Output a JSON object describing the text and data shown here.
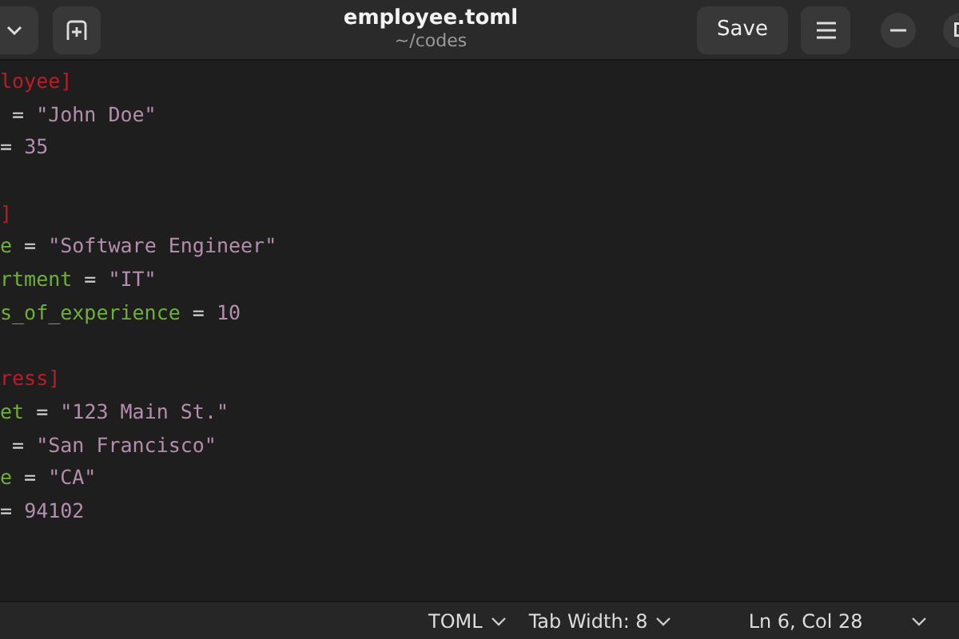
{
  "window": {
    "title": "employee.toml",
    "subtitle": "~/codes"
  },
  "header_buttons": [
    {
      "kind": "dropdown"
    },
    {
      "kind": "new-tab"
    }
  ],
  "save_button": "Save",
  "editor": {
    "blocks": [
      [
        [
          {
            "kind": "header",
            "text": "loyee]"
          }
        ],
        [
          {
            "kind": "op",
            "text": " = "
          },
          {
            "kind": "value",
            "text": "\"John Doe\""
          }
        ],
        [
          {
            "kind": "op",
            "text": "= "
          },
          {
            "kind": "value",
            "text": "35"
          }
        ]
      ],
      [
        [
          {
            "kind": "header",
            "text": "]"
          }
        ],
        [
          {
            "kind": "key",
            "text": "e"
          },
          {
            "kind": "op",
            "text": " = "
          },
          {
            "kind": "value",
            "text": "\"Software Engineer\""
          }
        ],
        [
          {
            "kind": "key",
            "text": "rtment"
          },
          {
            "kind": "op",
            "text": " = "
          },
          {
            "kind": "value",
            "text": "\"IT\""
          }
        ],
        [
          {
            "kind": "key",
            "text": "s_of_experience"
          },
          {
            "kind": "op",
            "text": " = "
          },
          {
            "kind": "value",
            "text": "10"
          }
        ]
      ],
      [
        [
          {
            "kind": "header",
            "text": "ress]"
          }
        ],
        [
          {
            "kind": "key",
            "text": "et"
          },
          {
            "kind": "op",
            "text": " = "
          },
          {
            "kind": "value",
            "text": "\"123 Main St.\""
          }
        ],
        [
          {
            "kind": "op",
            "text": " = "
          },
          {
            "kind": "value",
            "text": "\"San Francisco\""
          }
        ],
        [
          {
            "kind": "key",
            "text": "e"
          },
          {
            "kind": "op",
            "text": " = "
          },
          {
            "kind": "value",
            "text": "\"CA\""
          }
        ],
        [
          {
            "kind": "op",
            "text": "= "
          },
          {
            "kind": "value",
            "text": "94102"
          }
        ]
      ]
    ]
  },
  "status_bar": {
    "language": "TOML",
    "tab_width": "Tab Width: 8",
    "position": "Ln 6, Col 28"
  }
}
